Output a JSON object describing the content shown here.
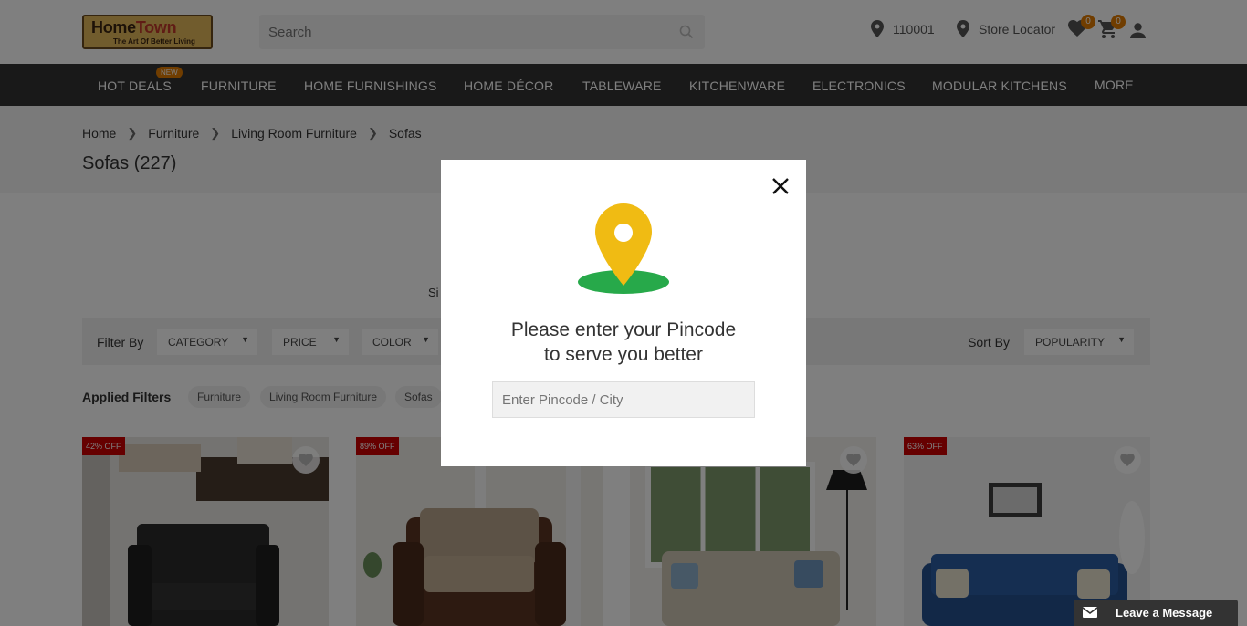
{
  "header": {
    "logo_text_main": "Home",
    "logo_text_accent": "Town",
    "logo_tagline": "The Art Of Better Living",
    "search_placeholder": "Search",
    "pincode": "110001",
    "store_locator": "Store Locator",
    "wishlist_count": "0",
    "cart_count": "0"
  },
  "nav": {
    "new_tag": "NEW",
    "items": [
      "HOT DEALS",
      "FURNITURE",
      "HOME FURNISHINGS",
      "HOME DÉCOR",
      "TABLEWARE",
      "KITCHENWARE",
      "ELECTRONICS",
      "MODULAR KITCHENS",
      "MORE"
    ]
  },
  "breadcrumb": [
    "Home",
    "Furniture",
    "Living Room Furniture",
    "Sofas"
  ],
  "page_title": "Sofas (227)",
  "partial_text": "Si",
  "filters": {
    "label": "Filter By",
    "items": [
      "CATEGORY",
      "PRICE",
      "COLOR"
    ],
    "sort_label": "Sort By",
    "sort_value": "POPULARITY"
  },
  "applied_filters": {
    "label": "Applied Filters",
    "chips": [
      "Furniture",
      "Living Room Furniture",
      "Sofas"
    ]
  },
  "products": [
    {
      "discount": "42% OFF"
    },
    {
      "discount": "89% OFF"
    },
    {
      "discount": ""
    },
    {
      "discount": "63% OFF"
    }
  ],
  "modal": {
    "line1": "Please enter your Pincode",
    "line2": "to serve you better",
    "input_placeholder": "Enter Pincode / City"
  },
  "chat": {
    "label": "Leave a Message"
  },
  "colors": {
    "nav_bg": "#333333",
    "badge": "#e07b00",
    "discount": "#cc0000",
    "pin_yellow": "#f0bb13",
    "pin_green": "#27a94a"
  }
}
